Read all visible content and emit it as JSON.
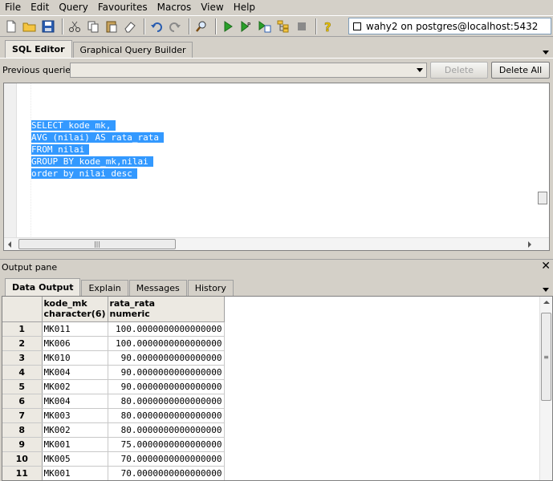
{
  "menu": [
    "File",
    "Edit",
    "Query",
    "Favourites",
    "Macros",
    "View",
    "Help"
  ],
  "connection": "wahy2 on postgres@localhost:5432",
  "sql_tabs": [
    "SQL Editor",
    "Graphical Query Builder"
  ],
  "previous_queries_label": "Previous queries",
  "delete_label": "Delete",
  "delete_all_label": "Delete All",
  "sql_lines": [
    "SELECT kode_mk,",
    "AVG (nilai) AS rata_rata",
    "FROM nilai",
    "GROUP BY kode_mk,nilai",
    "order by nilai desc"
  ],
  "output_pane_label": "Output pane",
  "output_tabs": [
    "Data Output",
    "Explain",
    "Messages",
    "History"
  ],
  "columns": [
    {
      "name": "kode_mk",
      "type": "character(6)"
    },
    {
      "name": "rata_rata",
      "type": "numeric"
    }
  ],
  "rows": [
    {
      "n": "1",
      "kode_mk": "MK011",
      "rata_rata": "100.0000000000000000"
    },
    {
      "n": "2",
      "kode_mk": "MK006",
      "rata_rata": "100.0000000000000000"
    },
    {
      "n": "3",
      "kode_mk": "MK010",
      "rata_rata": "90.0000000000000000"
    },
    {
      "n": "4",
      "kode_mk": "MK004",
      "rata_rata": "90.0000000000000000"
    },
    {
      "n": "5",
      "kode_mk": "MK002",
      "rata_rata": "90.0000000000000000"
    },
    {
      "n": "6",
      "kode_mk": "MK004",
      "rata_rata": "80.0000000000000000"
    },
    {
      "n": "7",
      "kode_mk": "MK003",
      "rata_rata": "80.0000000000000000"
    },
    {
      "n": "8",
      "kode_mk": "MK002",
      "rata_rata": "80.0000000000000000"
    },
    {
      "n": "9",
      "kode_mk": "MK001",
      "rata_rata": "75.0000000000000000"
    },
    {
      "n": "10",
      "kode_mk": "MK005",
      "rata_rata": "70.0000000000000000"
    },
    {
      "n": "11",
      "kode_mk": "MK001",
      "rata_rata": "70.0000000000000000"
    }
  ]
}
